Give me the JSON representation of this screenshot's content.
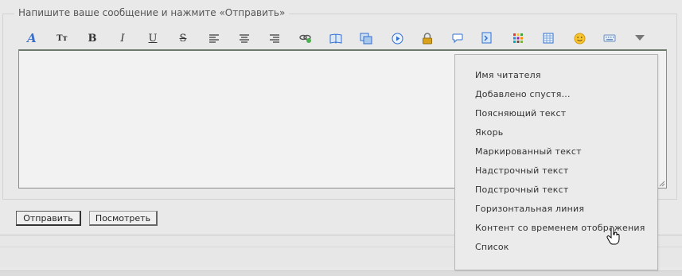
{
  "form": {
    "legend": "Напишите ваше сообщение и нажмите «Отправить»",
    "editor_value": ""
  },
  "toolbar": {
    "buttons": [
      {
        "name": "font-icon",
        "glyph": "A"
      },
      {
        "name": "font-size-icon",
        "glyph": "Tт"
      },
      {
        "name": "bold-icon",
        "glyph": "B"
      },
      {
        "name": "italic-icon",
        "glyph": "I"
      },
      {
        "name": "underline-icon",
        "glyph": "U"
      },
      {
        "name": "strikethrough-icon",
        "glyph": "S"
      },
      {
        "name": "align-left-icon"
      },
      {
        "name": "align-center-icon"
      },
      {
        "name": "align-right-icon"
      },
      {
        "name": "link-icon"
      },
      {
        "name": "book-icon"
      },
      {
        "name": "image-icon"
      },
      {
        "name": "media-play-icon"
      },
      {
        "name": "lock-icon"
      },
      {
        "name": "quote-bubble-icon"
      },
      {
        "name": "code-icon"
      },
      {
        "name": "color-grid-icon"
      },
      {
        "name": "table-icon"
      },
      {
        "name": "smiley-icon"
      },
      {
        "name": "keyboard-icon"
      },
      {
        "name": "more-dropdown-icon"
      }
    ]
  },
  "buttons": {
    "send": "Отправить",
    "preview": "Посмотреть"
  },
  "dropdown": {
    "items": [
      "Имя читателя",
      "Добавлено спустя...",
      "Поясняющий текст",
      "Якорь",
      "Маркированный текст",
      "Надстрочный текст",
      "Подстрочный текст",
      "Горизонтальная линия",
      "Контент со временем отображения",
      "Список"
    ]
  },
  "colors": {
    "background": "#e9e9e9",
    "editor_bg": "#f2f2f2",
    "accent_blue": "#2f6fd0",
    "lock_gold": "#d8a21a"
  }
}
